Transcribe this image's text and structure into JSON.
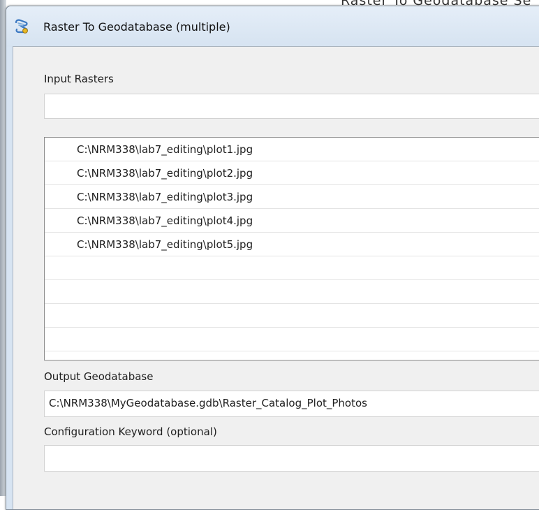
{
  "background_window_text": "Raster To Geodatabase Se",
  "window": {
    "title": "Raster To Geodatabase (multiple)",
    "icon": "python-script-tool-icon"
  },
  "form": {
    "input_rasters": {
      "label": "Input Rasters",
      "value": ""
    },
    "raster_list": {
      "items": [
        "C:\\NRM338\\lab7_editing\\plot1.jpg",
        "C:\\NRM338\\lab7_editing\\plot2.jpg",
        "C:\\NRM338\\lab7_editing\\plot3.jpg",
        "C:\\NRM338\\lab7_editing\\plot4.jpg",
        "C:\\NRM338\\lab7_editing\\plot5.jpg",
        "",
        "",
        "",
        ""
      ]
    },
    "output_geodatabase": {
      "label": "Output Geodatabase",
      "value": "C:\\NRM338\\MyGeodatabase.gdb\\Raster_Catalog_Plot_Photos"
    },
    "configuration_keyword": {
      "label": "Configuration Keyword (optional)",
      "value": ""
    }
  }
}
